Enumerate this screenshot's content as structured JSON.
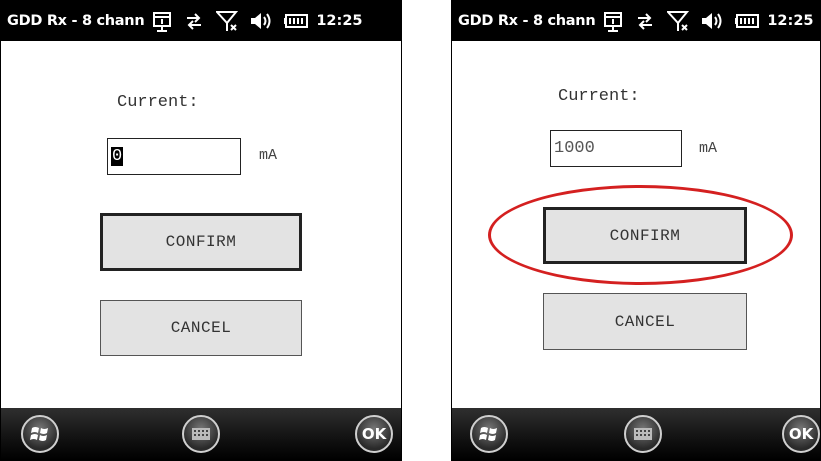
{
  "screens": [
    {
      "title": "GDD Rx - 8 chann",
      "clock": "12:25",
      "current_label": "Current:",
      "current_value": "0",
      "unit": "mA",
      "confirm_label": "CONFIRM",
      "cancel_label": "CANCEL",
      "ok_label": "OK"
    },
    {
      "title": "GDD Rx - 8 chann",
      "clock": "12:25",
      "current_label": "Current:",
      "current_value": "1000",
      "unit": "mA",
      "confirm_label": "CONFIRM",
      "cancel_label": "CANCEL",
      "ok_label": "OK"
    }
  ],
  "icons": [
    "calendar-icon",
    "sync-arrows-icon",
    "no-signal-icon",
    "speaker-icon",
    "battery-icon",
    "windows-start-icon",
    "keyboard-icon"
  ],
  "colors": {
    "titlebar": "#000000",
    "highlight": "#d42020",
    "button_bg": "#e3e3e3"
  }
}
